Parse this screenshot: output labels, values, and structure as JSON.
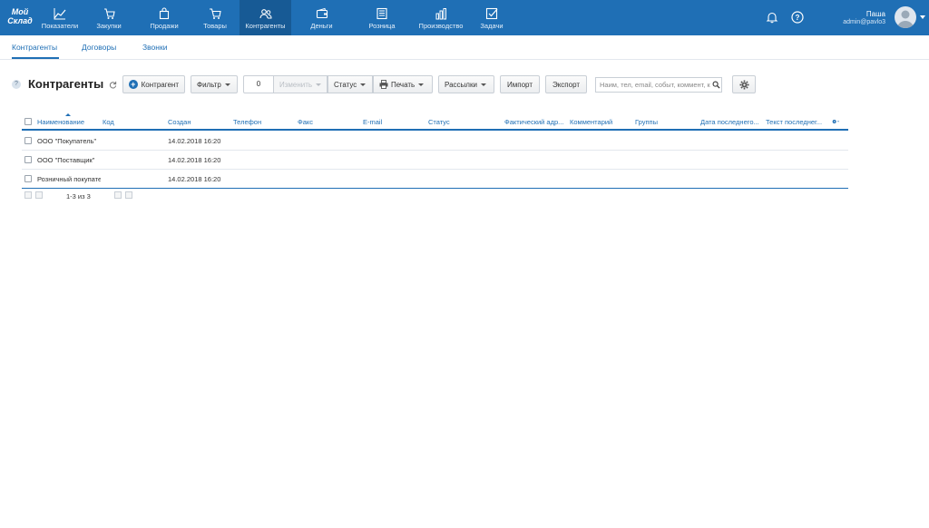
{
  "brand": {
    "logo_line1": "Мой",
    "logo_line2": "Склад"
  },
  "nav": {
    "items": [
      {
        "label": "Показатели",
        "icon": "chart-line-icon"
      },
      {
        "label": "Закупки",
        "icon": "cart-in-icon"
      },
      {
        "label": "Продажи",
        "icon": "bag-icon"
      },
      {
        "label": "Товары",
        "icon": "cart-icon"
      },
      {
        "label": "Контрагенты",
        "icon": "users-icon"
      },
      {
        "label": "Деньги",
        "icon": "wallet-icon"
      },
      {
        "label": "Розница",
        "icon": "register-icon"
      },
      {
        "label": "Производство",
        "icon": "factory-icon"
      },
      {
        "label": "Задачи",
        "icon": "task-check-icon"
      }
    ],
    "active": "Контрагенты"
  },
  "user": {
    "name": "Паша",
    "login": "admin@pavlo3"
  },
  "subtabs": [
    "Контрагенты",
    "Договоры",
    "Звонки"
  ],
  "toolbar": {
    "title": "Контрагенты",
    "help": "?",
    "add_label": "Контрагент",
    "filter_label": "Фильтр",
    "selected_count": "0",
    "change_label": "Изменить",
    "status_label": "Статус",
    "print_label": "Печать",
    "mailing_label": "Рассылки",
    "import_label": "Импорт",
    "export_label": "Экспорт",
    "search_placeholder": "Наим, тел, email, событ, коммент, к"
  },
  "table": {
    "columns": [
      "Наименование",
      "Код",
      "Создан",
      "Телефон",
      "Факс",
      "E-mail",
      "Статус",
      "Фактический адр...",
      "Комментарий",
      "Группы",
      "Дата последнего...",
      "Текст последнег..."
    ],
    "rows": [
      {
        "name": "ООО \"Покупатель\"",
        "code": "",
        "created": "14.02.2018 16:20"
      },
      {
        "name": "ООО \"Поставщик\"",
        "code": "",
        "created": "14.02.2018 16:20"
      },
      {
        "name": "Розничный покупатель",
        "code": "",
        "created": "14.02.2018 16:20"
      }
    ],
    "pager": "1-3 из 3"
  },
  "colors": {
    "brand_blue": "#1f6fb5",
    "active_nav": "#175a95"
  }
}
